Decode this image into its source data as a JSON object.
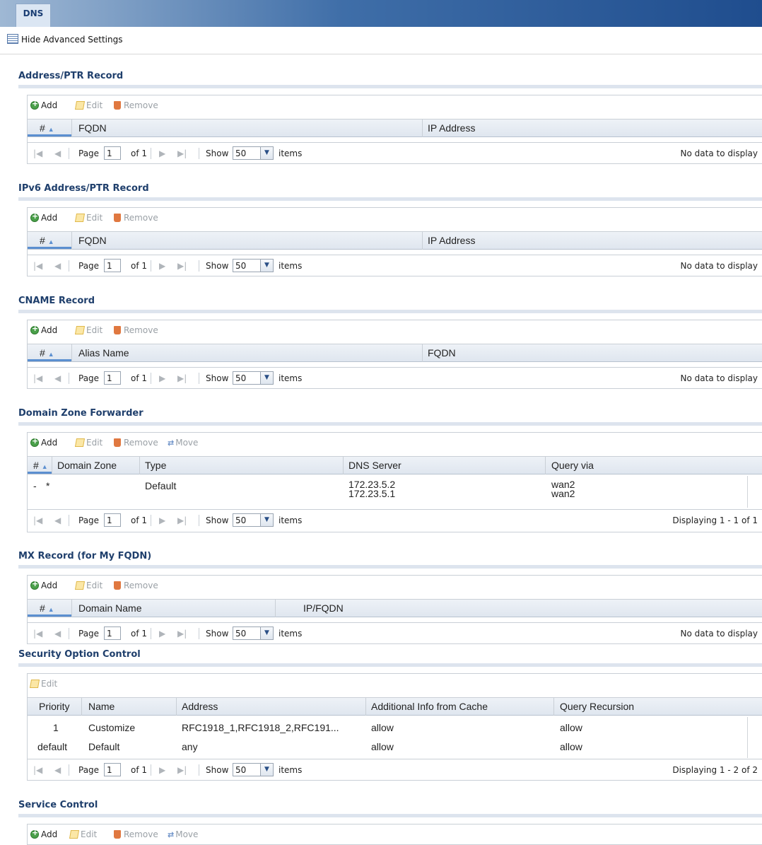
{
  "tab": "DNS",
  "advanced": "Hide Advanced Settings",
  "toolbar": {
    "add": "Add",
    "edit": "Edit",
    "remove": "Remove",
    "move": "Move"
  },
  "pager": {
    "page": "Page",
    "page_value": "1",
    "of": "of 1",
    "show": "Show",
    "show_value": "50",
    "items": "items"
  },
  "sections": {
    "addr": {
      "title": "Address/PTR Record",
      "cols": [
        "#",
        "FQDN",
        "IP Address"
      ],
      "status": "No data to display"
    },
    "ipv6": {
      "title": "IPv6 Address/PTR Record",
      "cols": [
        "#",
        "FQDN",
        "IP Address"
      ],
      "status": "No data to display"
    },
    "cname": {
      "title": "CNAME Record",
      "cols": [
        "#",
        "Alias Name",
        "FQDN"
      ],
      "status": "No data to display"
    },
    "dzf": {
      "title": "Domain Zone Forwarder",
      "cols": [
        "#",
        "Domain Zone",
        "Type",
        "DNS Server",
        "Query via"
      ],
      "rows": [
        {
          "num": "-",
          "zone": "*",
          "type": "Default",
          "dns1": "172.23.5.2",
          "dns2": "172.23.5.1",
          "via1": "wan2",
          "via2": "wan2"
        }
      ],
      "status": "Displaying 1 - 1 of 1"
    },
    "mx": {
      "title": "MX Record (for My FQDN)",
      "cols": [
        "#",
        "Domain Name",
        "IP/FQDN"
      ],
      "status": "No data to display"
    },
    "soc": {
      "title": "Security Option Control",
      "cols": [
        "Priority",
        "Name",
        "Address",
        "Additional Info from Cache",
        "Query Recursion"
      ],
      "rows": [
        {
          "priority": "1",
          "name": "Customize",
          "address": "RFC1918_1,RFC1918_2,RFC191...",
          "cache": "allow",
          "recursion": "allow"
        },
        {
          "priority": "default",
          "name": "Default",
          "address": "any",
          "cache": "allow",
          "recursion": "allow"
        }
      ],
      "status": "Displaying 1 - 2 of 2"
    },
    "svc": {
      "title": "Service Control"
    }
  }
}
